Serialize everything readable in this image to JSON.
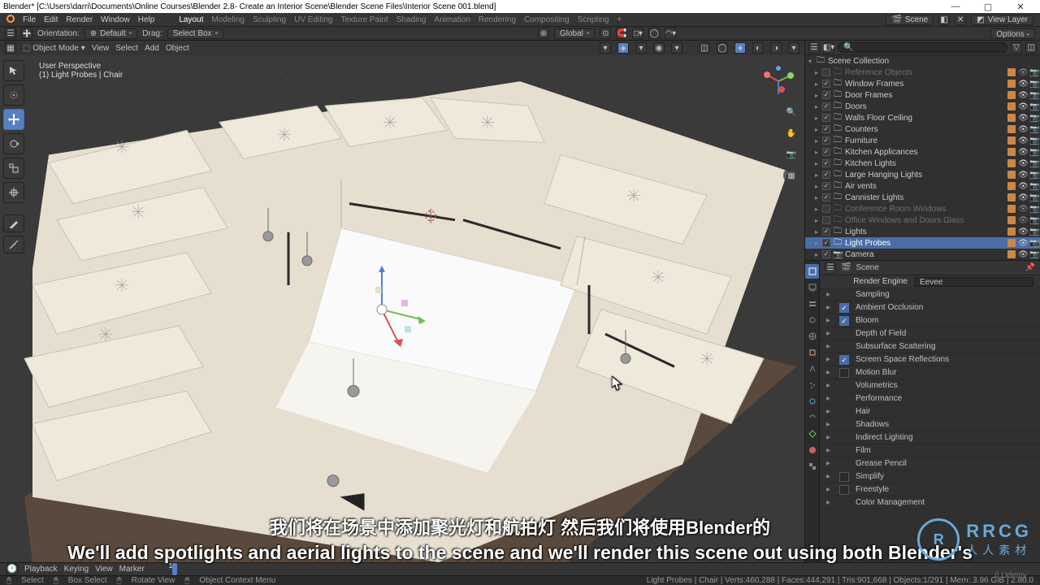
{
  "title": "Blender* [C:\\Users\\darri\\Documents\\Online Courses\\Blender 2.8- Create an Interior Scene\\Blender Scene Files\\Interior Scene 001.blend]",
  "menubar": {
    "logo": "⧉",
    "items": [
      "File",
      "Edit",
      "Render",
      "Window",
      "Help"
    ],
    "workspaces": [
      "Layout",
      "Modeling",
      "Sculpting",
      "UV Editing",
      "Texture Paint",
      "Shading",
      "Animation",
      "Rendering",
      "Compositing",
      "Scripting",
      "+"
    ],
    "scene_label": "Scene",
    "layer_label": "View Layer"
  },
  "toolbar": {
    "orientation_label": "Orientation:",
    "orientation_value": "Default",
    "drag_label": "Drag:",
    "drag_value": "Select Box",
    "trans_orient": "Global",
    "options": "Options"
  },
  "vp": {
    "mode": "Object Mode",
    "menus": [
      "View",
      "Select",
      "Add",
      "Object"
    ],
    "info1": "User Perspective",
    "info2": "(1) Light Probes | Chair"
  },
  "outliner": {
    "root": "Scene Collection",
    "search_placeholder": "",
    "items": [
      {
        "name": "Reference Objects",
        "type": "col",
        "checked": false,
        "dim": true
      },
      {
        "name": "Window Frames",
        "type": "col",
        "checked": true,
        "sel": false
      },
      {
        "name": "Door Frames",
        "type": "col",
        "checked": true
      },
      {
        "name": "Doors",
        "type": "col",
        "checked": true
      },
      {
        "name": "Walls Floor Ceiling",
        "type": "col",
        "checked": true
      },
      {
        "name": "Counters",
        "type": "col",
        "checked": true
      },
      {
        "name": "Furniture",
        "type": "col",
        "checked": true
      },
      {
        "name": "Kitchen Applicances",
        "type": "col",
        "checked": true
      },
      {
        "name": "Kitchen Lights",
        "type": "col",
        "checked": true
      },
      {
        "name": "Large Hanging Lights",
        "type": "col",
        "checked": true
      },
      {
        "name": "Air vents",
        "type": "col",
        "checked": true
      },
      {
        "name": "Cannister Lights",
        "type": "col",
        "checked": true
      },
      {
        "name": "Conference Room Windows",
        "type": "col",
        "checked": false,
        "dim": true
      },
      {
        "name": "Office Windows and Doors Glass",
        "type": "col",
        "checked": false,
        "dim": true
      },
      {
        "name": "Lights",
        "type": "col",
        "checked": true
      },
      {
        "name": "Light Probes",
        "type": "col",
        "checked": true,
        "sel": true
      },
      {
        "name": "Camera",
        "type": "obj",
        "checked": true
      }
    ]
  },
  "props": {
    "header": "Scene",
    "engine_label": "Render Engine",
    "engine_value": "Eevee",
    "panels": [
      {
        "name": "Sampling",
        "check": null
      },
      {
        "name": "Ambient Occlusion",
        "check": true
      },
      {
        "name": "Bloom",
        "check": true
      },
      {
        "name": "Depth of Field",
        "check": null
      },
      {
        "name": "Subsurface Scattering",
        "check": null
      },
      {
        "name": "Screen Space Reflections",
        "check": true
      },
      {
        "name": "Motion Blur",
        "check": false
      },
      {
        "name": "Volumetrics",
        "check": null
      },
      {
        "name": "Performance",
        "check": null
      },
      {
        "name": "Hair",
        "check": null
      },
      {
        "name": "Shadows",
        "check": null
      },
      {
        "name": "Indirect Lighting",
        "check": null
      },
      {
        "name": "Film",
        "check": null
      },
      {
        "name": "Grease Pencil",
        "check": null
      },
      {
        "name": "Simplify",
        "check": false
      },
      {
        "name": "Freestyle",
        "check": false
      },
      {
        "name": "Color Management",
        "check": null
      }
    ]
  },
  "timeline": {
    "menus": [
      "Playback",
      "Keying",
      "View",
      "Marker"
    ],
    "frame": "1"
  },
  "status": {
    "left": [
      "Select",
      "Box Select",
      "Rotate View",
      "Object Context Menu"
    ],
    "right": "Light Probes | Chair   |  Verts:460,288  |  Faces:444,291  |  Tris:901,668  |  Objects:1/291  |  Mem: 3.96 GiB  |  2.80.0"
  },
  "subtitles": {
    "cn": "我们将在场景中添加聚光灯和航拍灯 然后我们将使用Blender的",
    "en": "We'll add spotlights and aerial lights to the scene and we'll render this scene out using both Blender's"
  },
  "watermark": {
    "l1": "RRCG",
    "l2": "人人素材"
  }
}
